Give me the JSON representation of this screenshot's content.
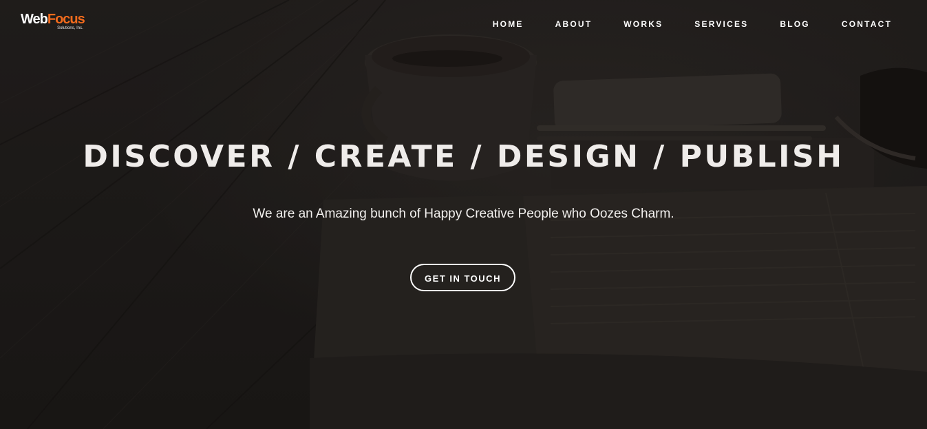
{
  "logo": {
    "word_web": "Web",
    "word_focus": "Focus",
    "subtitle": "Solutions, Inc."
  },
  "nav": {
    "items": [
      {
        "label": "HOME"
      },
      {
        "label": "ABOUT"
      },
      {
        "label": "WORKS"
      },
      {
        "label": "SERVICES"
      },
      {
        "label": "BLOG"
      },
      {
        "label": "CONTACT"
      }
    ]
  },
  "hero": {
    "headline": "DISCOVER / CREATE / DESIGN / PUBLISH",
    "tagline": "We are an Amazing bunch of Happy Creative People who Oozes Charm.",
    "cta_label": "GET IN TOUCH"
  },
  "colors": {
    "brand_accent": "#f26b1d",
    "text": "#ffffff",
    "background": "#1f1d1b"
  },
  "icons": {
    "background_photo": "desk-coffee-phone-newspaper-photo"
  }
}
